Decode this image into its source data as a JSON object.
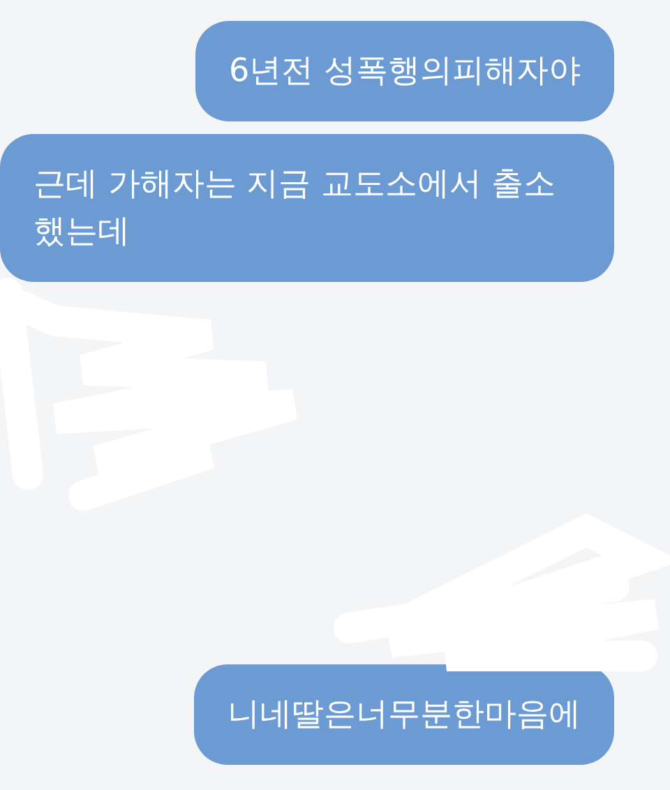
{
  "messages": [
    {
      "kind": "sent",
      "text": "6년전 성폭행의피해자야"
    },
    {
      "kind": "sent",
      "text": "근데 가해자는 지금 교도소에서 출소했는데"
    },
    {
      "kind": "gap"
    },
    {
      "kind": "sent",
      "text": "니네딸은너무분한마음에"
    }
  ]
}
